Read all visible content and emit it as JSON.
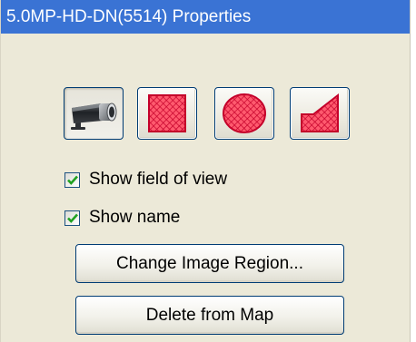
{
  "window": {
    "title": "5.0MP-HD-DN(5514) Properties"
  },
  "toolbar": {
    "buttons": [
      {
        "name": "camera-tool",
        "icon": "camera-icon"
      },
      {
        "name": "rectangle-region-tool",
        "icon": "rectangle-region-icon"
      },
      {
        "name": "ellipse-region-tool",
        "icon": "ellipse-region-icon"
      },
      {
        "name": "polygon-region-tool",
        "icon": "polygon-region-icon"
      }
    ]
  },
  "options": {
    "show_field_of_view": {
      "label": "Show field of view",
      "checked": true
    },
    "show_name": {
      "label": "Show name",
      "checked": true
    }
  },
  "actions": {
    "change_image_region": "Change Image Region...",
    "delete_from_map": "Delete from Map"
  },
  "colors": {
    "title_bar": "#3a73d4",
    "panel_background": "#ece9d8",
    "region_fill": "#ff5a6e",
    "region_hatch": "#c4002a",
    "checkmark": "#21a121"
  }
}
